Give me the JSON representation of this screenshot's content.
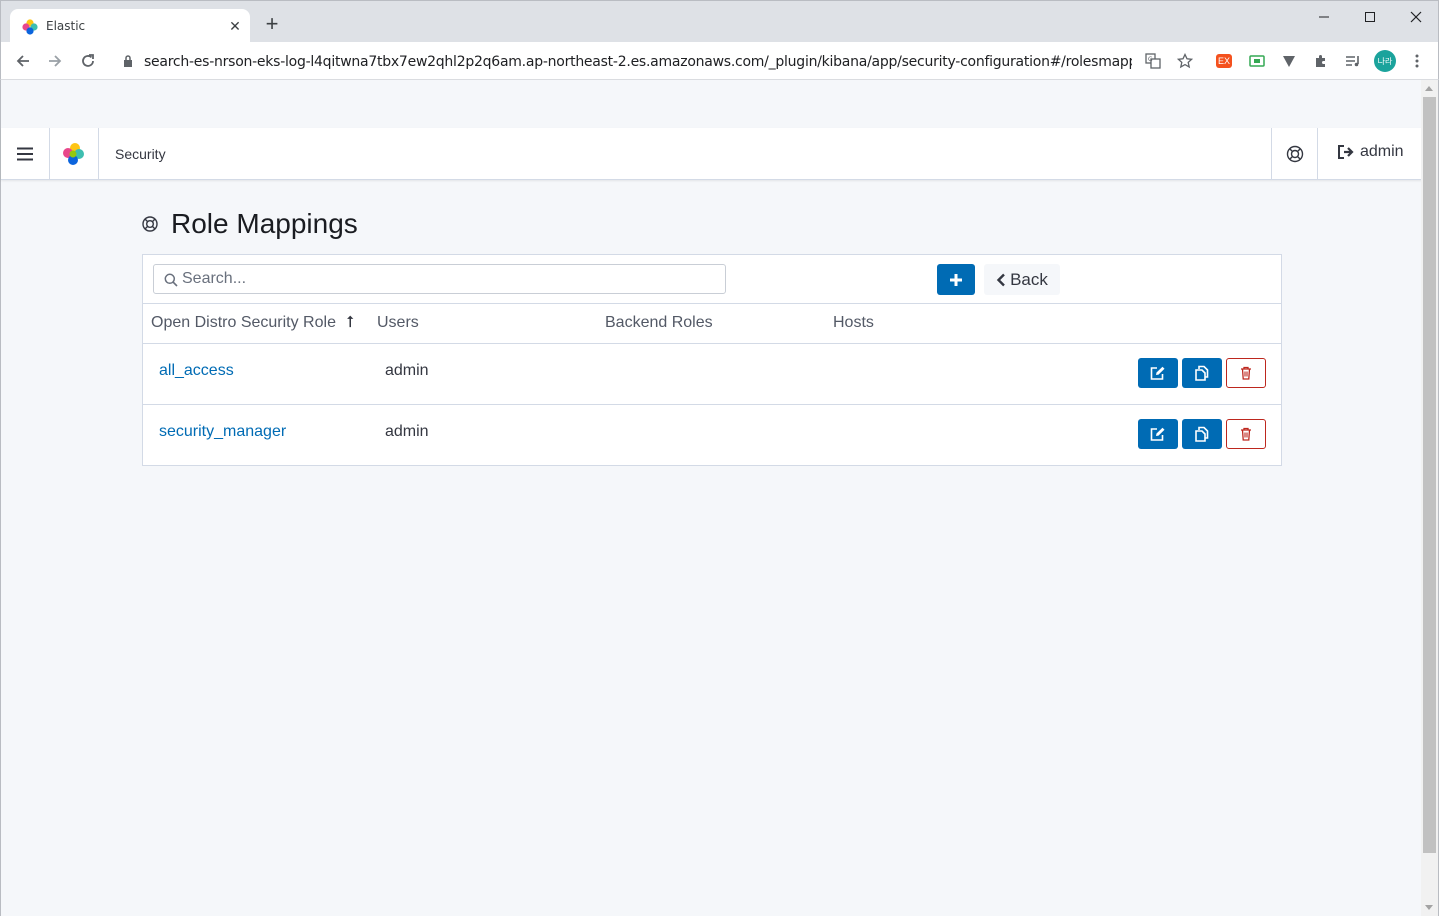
{
  "browser": {
    "tab_title": "Elastic",
    "url": "search-es-nrson-eks-log-l4qitwna7tbx7ew2qhl2p2q6am.ap-northeast-2.es.amazonaws.com/_plugin/kibana/app/security-configuration#/rolesmapping?_g=()",
    "profile_initials": "나라",
    "extension_labels": {
      "ex": "EX"
    }
  },
  "header": {
    "breadcrumb": "Security",
    "user": "admin"
  },
  "page": {
    "title": "Role Mappings",
    "search_placeholder": "Search...",
    "back_label": "Back"
  },
  "table": {
    "columns": [
      "Open Distro Security Role",
      "Users",
      "Backend Roles",
      "Hosts"
    ],
    "sort_indicator": "⭡",
    "rows": [
      {
        "role": "all_access",
        "users": "admin",
        "backend_roles": "",
        "hosts": ""
      },
      {
        "role": "security_manager",
        "users": "admin",
        "backend_roles": "",
        "hosts": ""
      }
    ]
  },
  "colors": {
    "primary": "#006bb4",
    "danger": "#bd271e",
    "page_bg": "#f5f7fa"
  },
  "icons": {
    "edit": "pencil-square-icon",
    "copy": "copy-icon",
    "delete": "trash-icon",
    "add": "plus-icon",
    "back": "chevron-left-icon",
    "help": "lifebuoy-icon",
    "logout": "sign-out-icon"
  }
}
